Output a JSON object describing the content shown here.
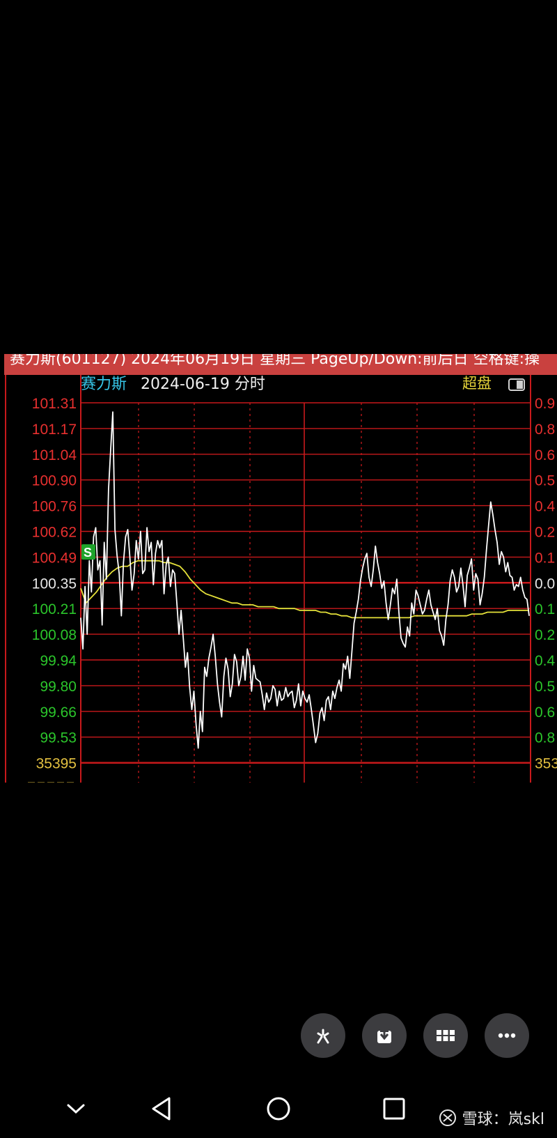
{
  "screenshot": {
    "title_bar": "赛力斯(601127) 2024年06月19日 星期三 PageUp/Down:前后日 空格键:操",
    "stock_name": "赛力斯",
    "date_label": "2024-06-19 分时",
    "super_label": "超盘",
    "left_axis_labels": [
      "101.31",
      "101.17",
      "101.04",
      "100.90",
      "100.76",
      "100.62",
      "100.49",
      "100.35",
      "100.21",
      "100.08",
      "99.94",
      "99.80",
      "99.66",
      "99.53",
      "35395"
    ],
    "right_axis_labels": [
      "0.9",
      "0.8",
      "0.6",
      "0.5",
      "0.4",
      "0.2",
      "0.1",
      "0.0",
      "0.1",
      "0.2",
      "0.4",
      "0.5",
      "0.6",
      "0.8",
      "353"
    ],
    "signal_marker": "S",
    "colors": {
      "title_bar": "#c9413f",
      "grid": "#c8191b",
      "up": "#e8302f",
      "down": "#2bc52b",
      "neutral": "#e8e8e8",
      "volume": "#e3c040",
      "price_line": "#ffffff",
      "avg_line": "#e6e23a",
      "name": "#37c6e8"
    }
  },
  "chart_data": {
    "type": "line",
    "title": "2024-06-19 分时",
    "xlabel": "",
    "ylabel": "",
    "ylim": [
      99.4,
      101.31
    ],
    "series": [
      {
        "values": [
          100.14,
          99.97,
          100.31,
          100.05,
          100.45,
          100.28,
          100.58,
          100.63,
          100.4,
          100.45,
          100.1,
          100.55,
          100.35,
          100.84,
          101.05,
          101.26,
          100.62,
          100.48,
          100.38,
          100.15,
          100.44,
          100.58,
          100.62,
          100.47,
          100.29,
          100.38,
          100.56,
          100.46,
          100.61,
          100.38,
          100.4,
          100.63,
          100.5,
          100.55,
          100.32,
          100.49,
          100.56,
          100.52,
          100.56,
          100.27,
          100.43,
          100.47,
          100.31,
          100.4,
          100.38,
          100.22,
          100.05,
          100.18,
          100.03,
          99.87,
          99.95,
          99.76,
          99.64,
          99.74,
          99.56,
          99.43,
          99.63,
          99.52,
          99.87,
          99.82,
          99.92,
          99.98,
          100.05,
          99.93,
          99.78,
          99.68,
          99.6,
          99.82,
          99.92,
          99.86,
          99.71,
          99.78,
          99.94,
          99.9,
          99.77,
          99.82,
          99.93,
          99.8,
          99.97,
          99.92,
          99.74,
          99.88,
          99.81,
          99.8,
          99.79,
          99.72,
          99.64,
          99.73,
          99.68,
          99.7,
          99.77,
          99.75,
          99.66,
          99.74,
          99.69,
          99.7,
          99.76,
          99.71,
          99.73,
          99.74,
          99.65,
          99.69,
          99.78,
          99.66,
          99.74,
          99.7,
          99.68,
          99.72,
          99.64,
          99.55,
          99.46,
          99.51,
          99.62,
          99.65,
          99.58,
          99.69,
          99.71,
          99.64,
          99.74,
          99.7,
          99.76,
          99.8,
          99.74,
          99.89,
          99.86,
          99.93,
          99.81,
          99.96,
          100.11,
          100.17,
          100.24,
          100.34,
          100.41,
          100.46,
          100.49,
          100.36,
          100.31,
          100.4,
          100.53,
          100.44,
          100.38,
          100.3,
          100.34,
          100.22,
          100.13,
          100.21,
          100.3,
          100.27,
          100.35,
          100.17,
          100.03,
          100.0,
          99.98,
          100.09,
          100.04,
          100.22,
          100.16,
          100.29,
          100.26,
          100.21,
          100.16,
          100.18,
          100.24,
          100.29,
          100.21,
          100.17,
          100.13,
          100.19,
          100.07,
          100.04,
          99.99,
          100.13,
          100.21,
          100.34,
          100.4,
          100.36,
          100.28,
          100.31,
          100.41,
          100.32,
          100.2,
          100.37,
          100.41,
          100.46,
          100.29,
          100.38,
          100.35,
          100.21,
          100.27,
          100.36,
          100.51,
          100.64,
          100.77,
          100.7,
          100.62,
          100.55,
          100.43,
          100.5,
          100.47,
          100.39,
          100.44,
          100.37,
          100.36,
          100.29,
          100.32,
          100.31,
          100.36,
          100.29,
          100.25,
          100.24,
          100.15
        ]
      },
      {
        "values": [
          100.3,
          100.22,
          100.25,
          100.28,
          100.32,
          100.36,
          100.39,
          100.41,
          100.42,
          100.42,
          100.44,
          100.45,
          100.45,
          100.45,
          100.45,
          100.45,
          100.44,
          100.44,
          100.43,
          100.42,
          100.39,
          100.35,
          100.32,
          100.29,
          100.27,
          100.26,
          100.25,
          100.24,
          100.23,
          100.22,
          100.22,
          100.21,
          100.21,
          100.21,
          100.2,
          100.2,
          100.2,
          100.2,
          100.19,
          100.19,
          100.19,
          100.19,
          100.18,
          100.18,
          100.18,
          100.18,
          100.17,
          100.17,
          100.16,
          100.16,
          100.15,
          100.15,
          100.14,
          100.14,
          100.14,
          100.14,
          100.14,
          100.14,
          100.14,
          100.14,
          100.14,
          100.14,
          100.14,
          100.14,
          100.15,
          100.15,
          100.15,
          100.15,
          100.15,
          100.15,
          100.15,
          100.15,
          100.15,
          100.15,
          100.15,
          100.16,
          100.16,
          100.16,
          100.17,
          100.17,
          100.17,
          100.17,
          100.18,
          100.18,
          100.18,
          100.18,
          100.18
        ]
      }
    ]
  },
  "action_buttons": [
    {
      "name": "edit-tool-icon"
    },
    {
      "name": "download-icon"
    },
    {
      "name": "grid-apps-icon"
    },
    {
      "name": "more-icon"
    }
  ],
  "watermark": {
    "text": "雪球：岚skl"
  }
}
